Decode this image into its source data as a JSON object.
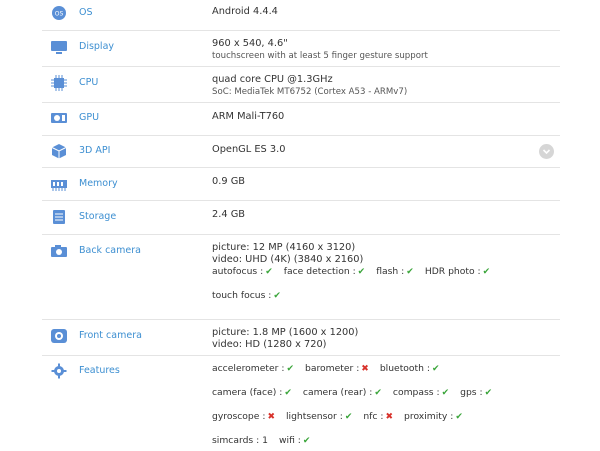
{
  "rows": {
    "os": {
      "label": "OS",
      "value": "Android 4.4.4",
      "icon": "os-icon"
    },
    "display": {
      "label": "Display",
      "value": "960 x 540, 4.6\"",
      "sub": "touchscreen with at least 5 finger gesture support",
      "icon": "display-icon"
    },
    "cpu": {
      "label": "CPU",
      "value": "quad core CPU @1.3GHz",
      "sub": "SoC: MediaTek MT6752 (Cortex A53 - ARMv7)",
      "icon": "cpu-icon"
    },
    "gpu": {
      "label": "GPU",
      "value": "ARM Mali-T760",
      "icon": "gpu-icon"
    },
    "api": {
      "label": "3D API",
      "value": "OpenGL ES 3.0",
      "icon": "cube-icon"
    },
    "memory": {
      "label": "Memory",
      "value": "0.9 GB",
      "icon": "memory-icon"
    },
    "storage": {
      "label": "Storage",
      "value": "2.4 GB",
      "icon": "storage-icon"
    },
    "back_camera": {
      "label": "Back camera",
      "picture": "picture: 12 MP (4160 x 3120)",
      "video": "video: UHD (4K) (3840 x 2160)",
      "features": [
        {
          "name": "autofocus :",
          "ok": true
        },
        {
          "name": "face detection :",
          "ok": true
        },
        {
          "name": "flash :",
          "ok": true
        },
        {
          "name": "HDR photo :",
          "ok": true
        }
      ],
      "extra": [
        {
          "name": "touch focus :",
          "ok": true
        }
      ],
      "icon": "camera-icon"
    },
    "front_camera": {
      "label": "Front camera",
      "picture": "picture: 1.8 MP (1600 x 1200)",
      "video": "video: HD (1280 x 720)",
      "icon": "front-camera-icon"
    },
    "features": {
      "label": "Features",
      "icon": "gear-icon",
      "lines": [
        [
          {
            "name": "accelerometer :",
            "ok": true
          },
          {
            "name": "barometer :",
            "ok": false
          },
          {
            "name": "bluetooth :",
            "ok": true
          }
        ],
        [
          {
            "name": "camera (face) :",
            "ok": true
          },
          {
            "name": "camera (rear) :",
            "ok": true
          },
          {
            "name": "compass :",
            "ok": true
          },
          {
            "name": "gps :",
            "ok": true
          }
        ],
        [
          {
            "name": "gyroscope :",
            "ok": false
          },
          {
            "name": "lightsensor :",
            "ok": true
          },
          {
            "name": "nfc :",
            "ok": false
          },
          {
            "name": "proximity :",
            "ok": true
          }
        ],
        [
          {
            "name": "simcards : 1",
            "ok": null
          },
          {
            "name": "wifi :",
            "ok": true
          }
        ]
      ]
    }
  },
  "colors": {
    "label": "#3d8fd1",
    "icon": "#5a8fd6",
    "check": "#3aa53a",
    "cross": "#d8322b",
    "divider": "#e4e4e4"
  },
  "marks": {
    "check": "✔",
    "cross": "✖"
  }
}
